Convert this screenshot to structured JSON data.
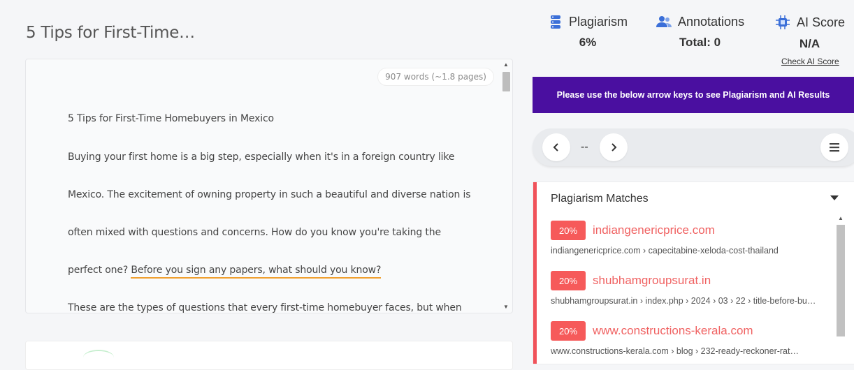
{
  "doc": {
    "title": "5 Tips for First-Time…",
    "word_count": "907 words (~1.8 pages)",
    "heading": "5 Tips for First-Time Homebuyers in Mexico",
    "lines": [
      "Buying your first home is a big step, especially when it's in a foreign country like",
      "Mexico. The excitement of owning property in such a beautiful and diverse nation is",
      "often mixed with questions and concerns. How do you know you're taking the"
    ],
    "line4_prefix": "perfect one? ",
    "line4_highlight": "Before you sign any papers, what should you know?",
    "line5": "These are the types of questions that every first-time homebuyer faces, but when"
  },
  "stats": {
    "plagiarism": {
      "label": "Plagiarism",
      "value": "6%"
    },
    "annotations": {
      "label": "Annotations",
      "value": "Total: 0"
    },
    "ai_score": {
      "label": "AI Score",
      "value": "N/A"
    },
    "check_ai": "Check AI Score"
  },
  "banner": "Please use the below arrow keys to see Plagiarism and AI Results",
  "nav": {
    "position": "--"
  },
  "matches_panel": {
    "title": "Plagiarism Matches",
    "items": [
      {
        "percent": "20%",
        "domain": "indiangenericprice.com",
        "path": "indiangenericprice.com › capecitabine-xeloda-cost-thailand"
      },
      {
        "percent": "20%",
        "domain": "shubhamgroupsurat.in",
        "path": "shubhamgroupsurat.in › index.php › 2024 › 03 › 22 › title-before-bu…"
      },
      {
        "percent": "20%",
        "domain": "www.constructions-kerala.com",
        "path": "www.constructions-kerala.com › blog › 232-ready-reckoner-rat…"
      }
    ]
  },
  "colors": {
    "accent": "#4a0fa0",
    "match_red": "#f65a5a",
    "highlight": "#f0a030"
  }
}
